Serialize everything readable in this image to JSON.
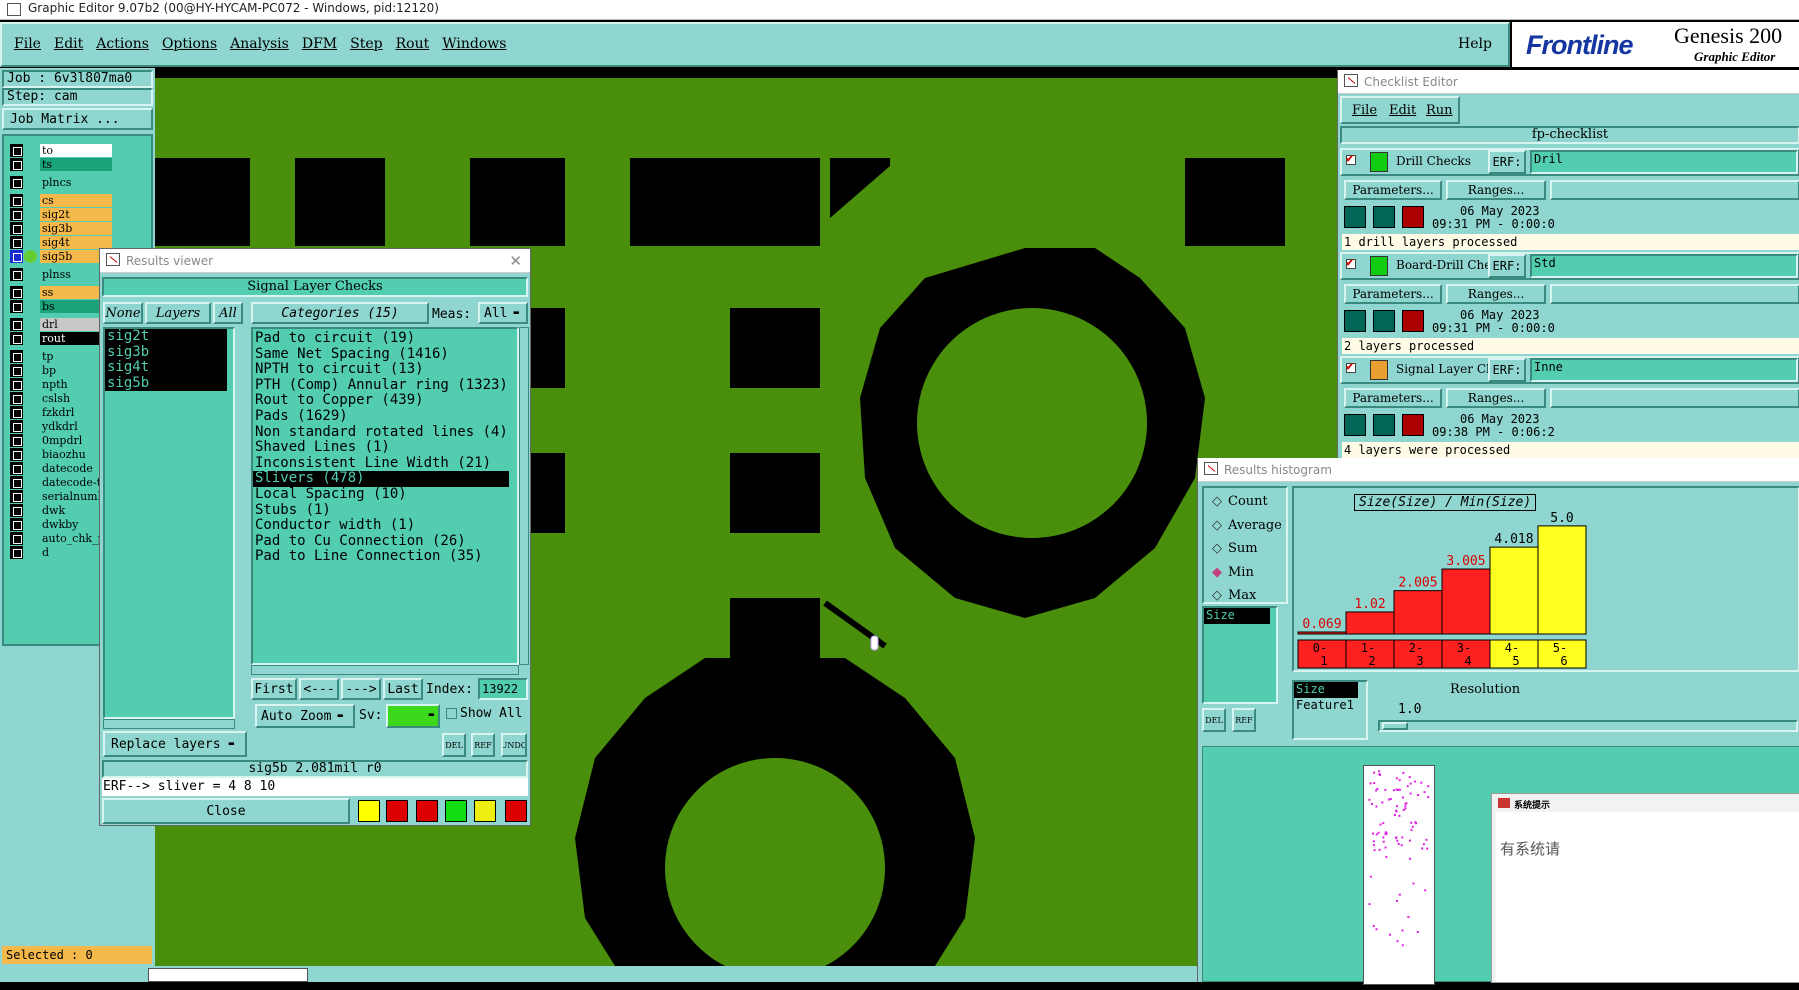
{
  "window_title": "Graphic Editor 9.07b2 (00@HY-HYCAM-PC072 - Windows, pid:12120)",
  "menu": {
    "items": [
      "File",
      "Edit",
      "Actions",
      "Options",
      "Analysis",
      "DFM",
      "Step",
      "Rout",
      "Windows"
    ],
    "help": "Help"
  },
  "brand": {
    "logo": "Frontline",
    "product": "Genesis 200",
    "subtitle": "Graphic Editor"
  },
  "job": {
    "job_label": "Job : 6v3l807ma0",
    "step_label": "Step: cam",
    "matrix_button": "Job Matrix ..."
  },
  "layers": [
    {
      "name": "to",
      "color": "#ffffff"
    },
    {
      "name": "ts",
      "color": "#1aa37a"
    },
    {
      "name": "plncs",
      "color": "#52cdb0"
    },
    {
      "name": "cs",
      "color": "#f5b84a"
    },
    {
      "name": "sig2t",
      "color": "#f5b84a"
    },
    {
      "name": "sig3b",
      "color": "#f5b84a"
    },
    {
      "name": "sig4t",
      "color": "#f5b84a"
    },
    {
      "name": "sig5b",
      "color": "#f5b84a"
    },
    {
      "name": "plnss",
      "color": "#52cdb0"
    },
    {
      "name": "ss",
      "color": "#f5b84a"
    },
    {
      "name": "bs",
      "color": "#1aa37a"
    },
    {
      "name": "drl",
      "color": "#c8c8c8"
    },
    {
      "name": "rout",
      "color": "#000000"
    },
    {
      "name": "tp",
      "color": "#52cdb0"
    },
    {
      "name": "bp",
      "color": "#52cdb0"
    },
    {
      "name": "npth",
      "color": "#52cdb0"
    },
    {
      "name": "cslsh",
      "color": "#52cdb0"
    },
    {
      "name": "fzkdrl",
      "color": "#52cdb0"
    },
    {
      "name": "ydkdrl",
      "color": "#52cdb0"
    },
    {
      "name": "0mpdrl",
      "color": "#52cdb0"
    },
    {
      "name": "biaozhu",
      "color": "#52cdb0"
    },
    {
      "name": "datecode",
      "color": "#52cdb0"
    },
    {
      "name": "datecode-t",
      "color": "#52cdb0"
    },
    {
      "name": "serialnumb",
      "color": "#52cdb0"
    },
    {
      "name": "dwk",
      "color": "#52cdb0"
    },
    {
      "name": "dwkby",
      "color": "#52cdb0"
    },
    {
      "name": "auto_chk_p",
      "color": "#52cdb0"
    },
    {
      "name": "d",
      "color": "#52cdb0"
    }
  ],
  "selected": "Selected : 0",
  "results_viewer": {
    "title": "Results viewer",
    "header": "Signal Layer Checks",
    "none_btn": "None",
    "layers_btn": "Layers",
    "all_btn": "All",
    "categories_btn": "Categories (15)",
    "meas_label": "Meas:",
    "meas_value": "All",
    "layer_list": [
      "sig2t",
      "sig3b",
      "sig4t",
      "sig5b"
    ],
    "categories": [
      "Pad to circuit (19)",
      "Same Net Spacing (1416)",
      "NPTH to circuit (13)",
      "PTH (Comp) Annular ring (1323)",
      "Rout to Copper (439)",
      "Pads (1629)",
      "Non standard rotated lines (4)",
      "Shaved Lines (1)",
      "Inconsistent Line Width (21)",
      "Slivers (478)",
      "Local Spacing (10)",
      "Stubs (1)",
      "Conductor width (1)",
      "Pad to Cu Connection (26)",
      "Pad to Line Connection (35)"
    ],
    "selected_category": "Slivers (478)",
    "nav": {
      "first": "First",
      "prev": "<---",
      "next": "--->",
      "last": "Last",
      "index_label": "Index:",
      "index_value": "13922"
    },
    "auto_zoom": "Auto Zoom",
    "sv_label": "Sv:",
    "show_all": "Show All",
    "replace_layers": "Replace layers",
    "status_line": "sig5b 2.081mil  r0",
    "erf_line": "ERF--> sliver = 4 8 10",
    "close": "Close",
    "mini_btns": [
      "DEL",
      "REF",
      "UNDO"
    ]
  },
  "checklist": {
    "title": "Checklist Editor",
    "menu": [
      "File",
      "Edit",
      "Run"
    ],
    "name": "fp-checklist",
    "items": [
      {
        "name": "Drill Checks",
        "erf_value": "Dril",
        "params": "Parameters...",
        "ranges": "Ranges...",
        "date": "06 May 2023",
        "time": "09:31 PM - 0:00:0",
        "msg": "1 drill layers processed",
        "erf": "ERF:"
      },
      {
        "name": "Board-Drill Che",
        "erf_value": "Std",
        "params": "Parameters...",
        "ranges": "Ranges...",
        "date": "06 May 2023",
        "time": "09:31 PM - 0:00:0",
        "msg": "2 layers processed",
        "erf": "ERF:"
      },
      {
        "name": "Signal Layer Ch",
        "erf_value": "Inne",
        "params": "Parameters...",
        "ranges": "Ranges...",
        "date": "06 May 2023",
        "time": "09:38 PM - 0:06:2",
        "msg": "4 layers were processed",
        "erf": "ERF:"
      }
    ]
  },
  "histogram": {
    "title": "Results histogram",
    "modes": [
      "Count",
      "Average",
      "Sum",
      "Min",
      "Max"
    ],
    "selected_mode": "Min",
    "field_list": [
      "Size"
    ],
    "chart_title": "Size(Size) / Min(Size)",
    "resolution_label": "Resolution",
    "resolution_value": "1.0",
    "field_list2": [
      "Size",
      "Feature1"
    ],
    "mini_btns": [
      "DEL",
      "REF"
    ],
    "chart_data": {
      "type": "bar",
      "categories": [
        "0-\n1",
        "1-\n2",
        "2-\n3",
        "3-\n4",
        "4-\n5",
        "5-\n6"
      ],
      "values": [
        0.069,
        1.02,
        2.005,
        3.005,
        4.018,
        5.0
      ],
      "value_labels": [
        "0.069",
        "1.02",
        "2.005",
        "3.005",
        "4.018",
        "5.0"
      ],
      "colors": [
        "#ff2020",
        "#ff2020",
        "#ff2020",
        "#ff2020",
        "#ffff20",
        "#ffff20"
      ]
    }
  },
  "popup_corner": {
    "title": "系统提示",
    "text": "有系统请"
  }
}
